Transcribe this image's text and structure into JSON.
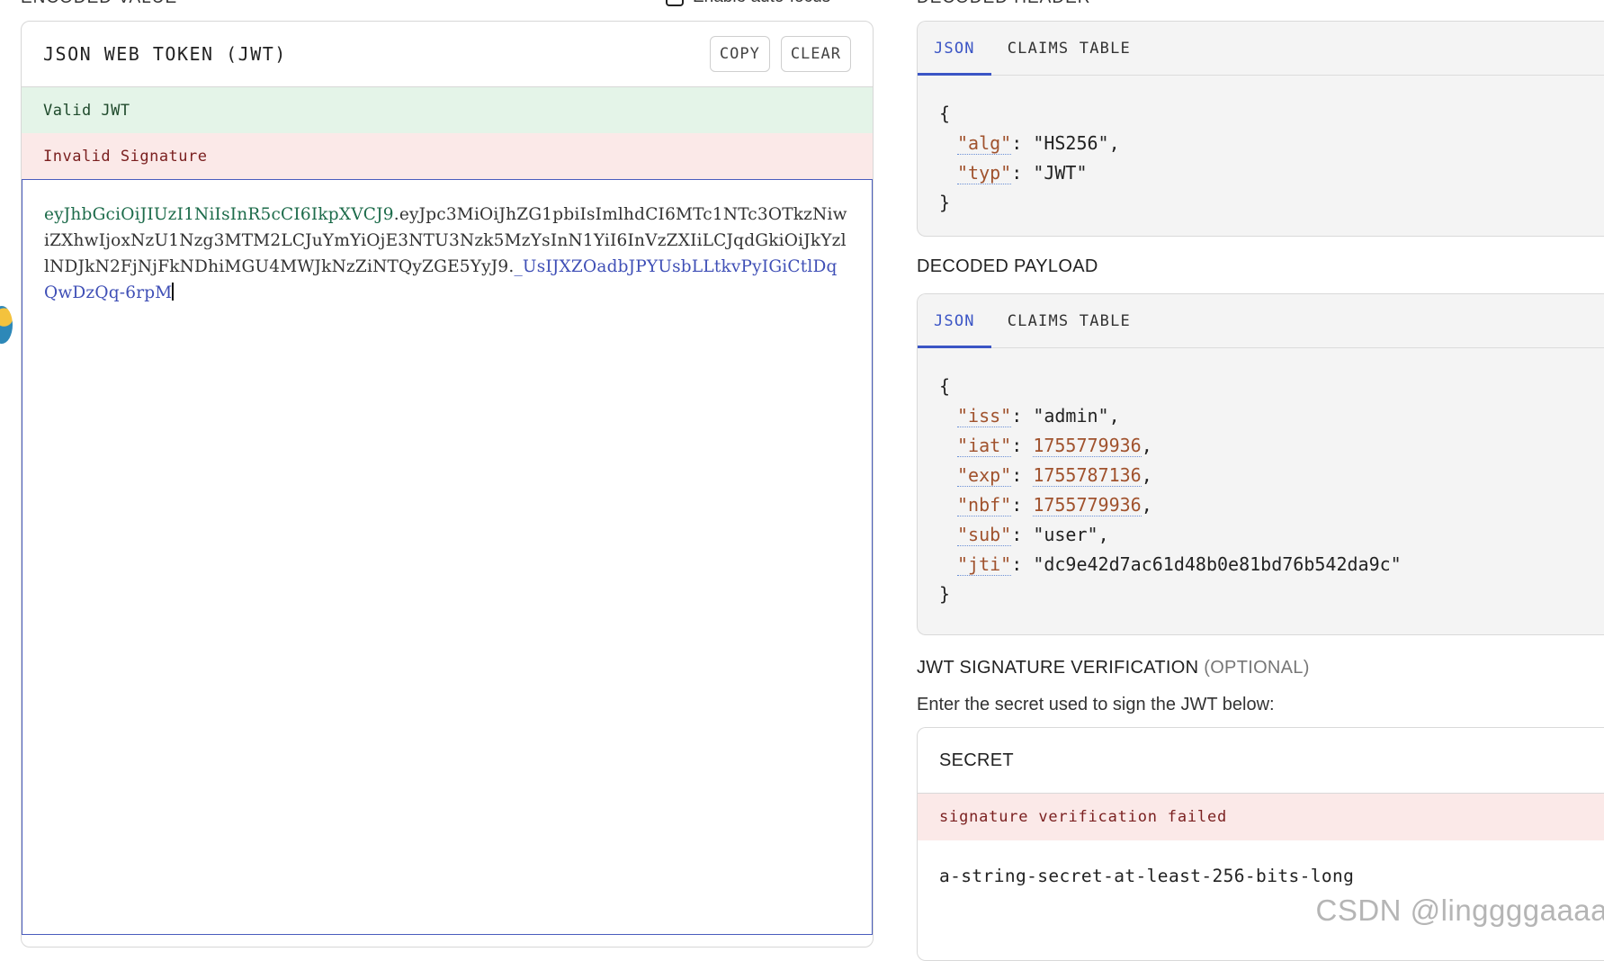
{
  "encoded": {
    "section_heading": "ENCODED VALUE",
    "auto_focus_label": "Enable auto-focus",
    "panel_title": "JSON WEB TOKEN (JWT)",
    "copy_label": "COPY",
    "clear_label": "CLEAR",
    "valid_status": "Valid JWT",
    "signature_status": "Invalid Signature",
    "token": {
      "header": "eyJhbGciOiJIUzI1NiIsInR5cCI6IkpXVCJ9",
      "payload": "eyJpc3MiOiJhZG1pbiIsImlhdCI6MTc1NTc3OTkzNiwiZXhwIjoxNzU1Nzg3MTM2LCJuYmYiOjE3NTU3Nzk5MzYsInN1YiI6InVzZXIiLCJqdGkiOiJkYzllNDJkN2FjNjFkNDhiMGU4MWJkNzZiNTQyZGE5YyJ9",
      "signature": "_UsIJXZOadbJPYUsbLLtkvPyIGiCtlDqQwDzQq-6rpM",
      "dot": "."
    }
  },
  "decoded_header": {
    "section_heading": "DECODED HEADER",
    "tabs": [
      "JSON",
      "CLAIMS TABLE"
    ],
    "open_brace": "{",
    "close_brace": "}",
    "fields": [
      {
        "key": "\"alg\"",
        "value": "\"HS256\"",
        "sep": ",",
        "type": "string"
      },
      {
        "key": "\"typ\"",
        "value": "\"JWT\"",
        "sep": "",
        "type": "string"
      }
    ]
  },
  "decoded_payload": {
    "section_heading": "DECODED PAYLOAD",
    "tabs": [
      "JSON",
      "CLAIMS TABLE"
    ],
    "open_brace": "{",
    "close_brace": "}",
    "fields": [
      {
        "key": "\"iss\"",
        "value": "\"admin\"",
        "sep": ",",
        "type": "string"
      },
      {
        "key": "\"iat\"",
        "value": "1755779936",
        "sep": ",",
        "type": "number"
      },
      {
        "key": "\"exp\"",
        "value": "1755787136",
        "sep": ",",
        "type": "number"
      },
      {
        "key": "\"nbf\"",
        "value": "1755779936",
        "sep": ",",
        "type": "number"
      },
      {
        "key": "\"sub\"",
        "value": "\"user\"",
        "sep": ",",
        "type": "string"
      },
      {
        "key": "\"jti\"",
        "value": "\"dc9e42d7ac61d48b0e81bd76b542da9c\"",
        "sep": "",
        "type": "string"
      }
    ]
  },
  "verification": {
    "heading": "JWT SIGNATURE VERIFICATION",
    "optional": "(OPTIONAL)",
    "hint": "Enter the secret used to sign the JWT below:",
    "secret_label": "SECRET",
    "error": "signature verification failed",
    "secret_value": "a-string-secret-at-least-256-bits-long"
  },
  "watermark": "CSDN @linggggaaaa",
  "colors": {
    "accent": "#3b55c5",
    "header_token": "#1c6b4a",
    "signature_token": "#3f4fb6",
    "valid_bg": "#e4f4e8",
    "invalid_bg": "#fbe9e8",
    "json_key": "#a0522d"
  }
}
